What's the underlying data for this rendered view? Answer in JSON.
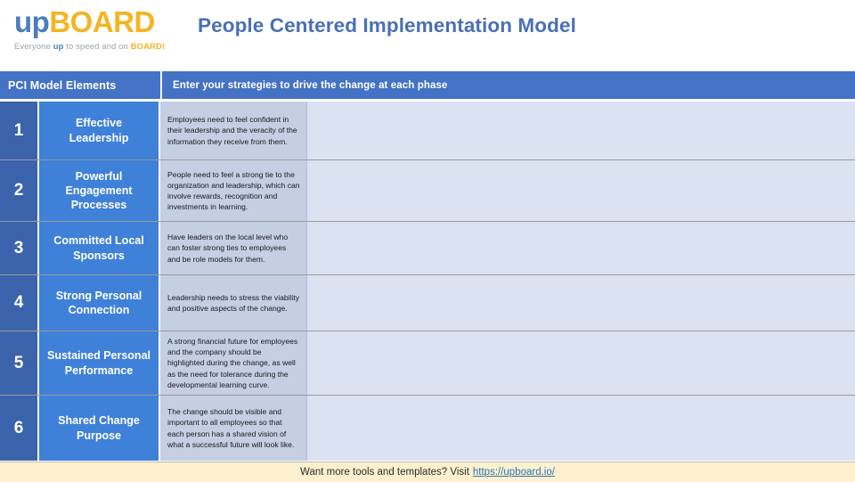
{
  "header": {
    "logo": {
      "name": "upBOARD",
      "part_up": "up",
      "part_board": "BOARD",
      "tagline_pre": "Everyone ",
      "tagline_up": "up",
      "tagline_mid": " to speed and on ",
      "tagline_board": "BOARD!"
    },
    "title": "People Centered Implementation Model"
  },
  "table": {
    "col_headers": {
      "elements": "PCI Model Elements",
      "strategies": "Enter your strategies to drive the change at each phase"
    },
    "rows": [
      {
        "num": "1",
        "label": "Effective Leadership",
        "desc": "Employees need to feel confident in their leadership and the veracity of the information they receive from them.",
        "strategy": ""
      },
      {
        "num": "2",
        "label": "Powerful Engagement Processes",
        "desc": "People need to feel a strong tie to the organization and leadership, which can involve rewards, recognition and investments in learning.",
        "strategy": ""
      },
      {
        "num": "3",
        "label": "Committed Local Sponsors",
        "desc": "Have leaders on the local level who can foster strong ties to employees and be role models for them.",
        "strategy": ""
      },
      {
        "num": "4",
        "label": "Strong Personal Connection",
        "desc": "Leadership needs to stress the viability and positive aspects of the change.",
        "strategy": ""
      },
      {
        "num": "5",
        "label": "Sustained Personal Performance",
        "desc": "A strong financial future for employees and the company should be highlighted during the change, as well as the need for tolerance during the developmental learning curve.",
        "strategy": ""
      },
      {
        "num": "6",
        "label": "Shared Change Purpose",
        "desc": "The change should be visible and important to all employees so that each person has a shared vision of what a successful future will look like.",
        "strategy": ""
      }
    ]
  },
  "footer": {
    "text": "Want more tools and templates? Visit",
    "link_text": "https://upboard.io/"
  },
  "colors": {
    "header_band": "#4472c4",
    "number_cell": "#3b63ab",
    "label_cell": "#3f80d8",
    "desc_cell": "#c5cfe3",
    "strategy_cell": "#dbe2f1",
    "title_blue": "#4a6fb5",
    "logo_orange": "#f5b425",
    "footer_bg": "#fdf0cf",
    "link_blue": "#2f74b5"
  }
}
